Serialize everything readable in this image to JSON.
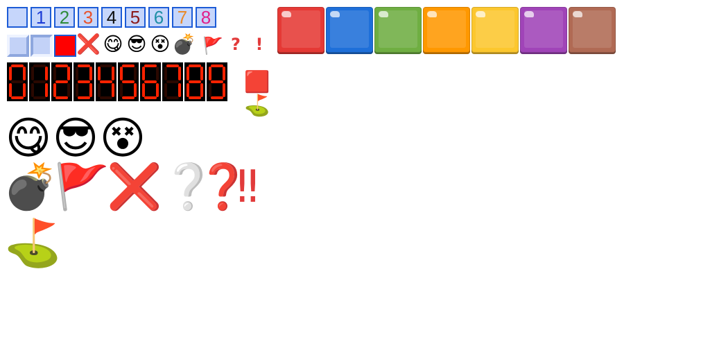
{
  "number_tiles": [
    {
      "label": "",
      "color": "#1c5bd6"
    },
    {
      "label": "1",
      "color": "#1c3cd6"
    },
    {
      "label": "2",
      "color": "#2e8b3a"
    },
    {
      "label": "3",
      "color": "#e8512a"
    },
    {
      "label": "4",
      "color": "#111111"
    },
    {
      "label": "5",
      "color": "#8b1a1a"
    },
    {
      "label": "6",
      "color": "#1f8fa6"
    },
    {
      "label": "7",
      "color": "#e8892a"
    },
    {
      "label": "8",
      "color": "#e0208a"
    }
  ],
  "small_icons": {
    "cross": "❌",
    "face_yum": "😋",
    "face_cool": "😎",
    "face_dizzy": "😵",
    "bomb": "💣",
    "flag": "🚩",
    "question": "?",
    "exclaim": "!"
  },
  "lcd_digits": [
    "0",
    "1",
    "2",
    "3",
    "4",
    "5",
    "6",
    "7",
    "8",
    "9"
  ],
  "lcd_color": "#ff2200",
  "side_icons": {
    "red_square": "🟥",
    "golf": "⛳"
  },
  "large_icons": {
    "face_yum": "😋",
    "face_cool": "😎",
    "face_dizzy": "😵",
    "bomb": "💣",
    "flag": "🚩",
    "cross": "❌",
    "white_question": "❔",
    "red_question": "❓",
    "double_exclaim": "‼",
    "golf": "⛳"
  },
  "color_blocks": [
    "#e53935",
    "#1e6fd9",
    "#6fae42",
    "#ff9800",
    "#fcc72e",
    "#a044b8",
    "#b06a54"
  ]
}
